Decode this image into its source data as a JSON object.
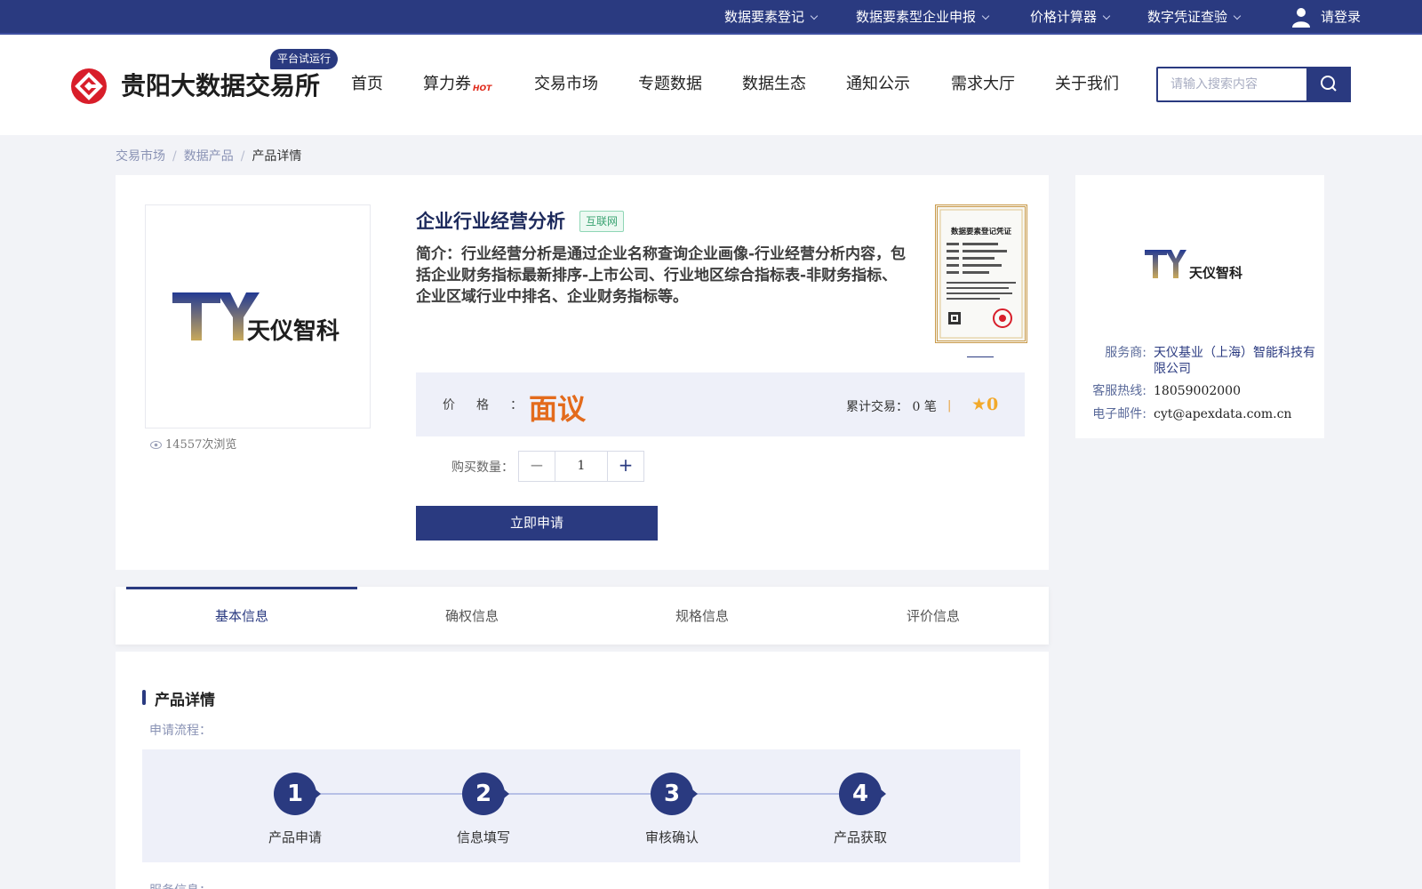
{
  "topbar": {
    "links": [
      "数据要素登记",
      "数据要素型企业申报",
      "价格计算器",
      "数字凭证查验"
    ],
    "login": "请登录"
  },
  "header": {
    "logo_text": "贵阳大数据交易所",
    "badge": "平台试运行",
    "nav": [
      "首页",
      "算力券",
      "交易市场",
      "专题数据",
      "数据生态",
      "通知公示",
      "需求大厅",
      "关于我们"
    ],
    "hot_label": "HOT",
    "search_placeholder": "请输入搜索内容"
  },
  "breadcrumb": [
    "交易市场",
    "数据产品",
    "产品详情"
  ],
  "product": {
    "title": "企业行业经营分析",
    "tag": "互联网",
    "description": "简介：行业经营分析是通过企业名称查询企业画像-行业经营分析内容，包括企业财务指标最新排序-上市公司、行业地区综合指标表-非财务指标、企业区域行业中排名、企业财务指标等。",
    "views": "14557次浏览",
    "logo_text": "天仪智科",
    "certificate_title": "数据要素登记凭证",
    "price_label": "价格：",
    "price_value": "面议",
    "trade_label": "累计交易：",
    "trade_count": "0",
    "trade_unit": "笔",
    "rating": "0",
    "qty_label": "购买数量：",
    "qty_value": "1",
    "apply_label": "立即申请"
  },
  "provider": {
    "logo_text": "天仪智科",
    "service_label": "服务商:",
    "service_value": "天仪基业（上海）智能科技有限公司",
    "hotline_label": "客服热线:",
    "hotline_value": "18059002000",
    "email_label": "电子邮件:",
    "email_value": "cyt@apexdata.com.cn"
  },
  "tabs": [
    "基本信息",
    "确权信息",
    "规格信息",
    "评价信息"
  ],
  "details": {
    "section_title": "产品详情",
    "flow_label": "申请流程：",
    "steps": [
      {
        "num": "1",
        "label": "产品申请"
      },
      {
        "num": "2",
        "label": "信息填写"
      },
      {
        "num": "3",
        "label": "审核确认"
      },
      {
        "num": "4",
        "label": "产品获取"
      }
    ],
    "service_info_label": "服务信息："
  },
  "colors": {
    "primary": "#2a3a80",
    "accent_orange": "#e36b1c",
    "star": "#f2a92b",
    "tag_green": "#3aa372",
    "logo_red": "#d81e2a"
  }
}
